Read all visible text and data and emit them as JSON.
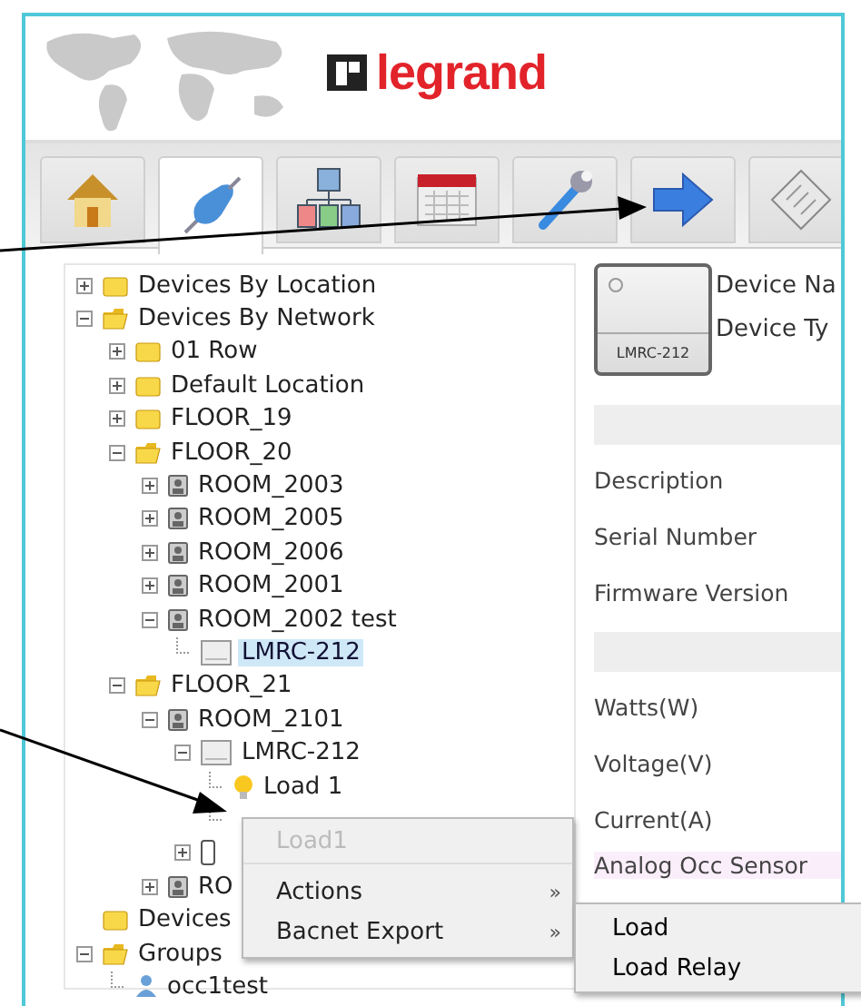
{
  "header": {
    "logo": "legrand"
  },
  "tabs": [
    {
      "kind": "home",
      "selected": false
    },
    {
      "kind": "plug",
      "selected": true
    },
    {
      "kind": "network",
      "selected": false
    },
    {
      "kind": "calendar",
      "selected": false
    },
    {
      "kind": "wrench",
      "selected": false
    },
    {
      "kind": "arrow",
      "selected": false
    },
    {
      "kind": "document",
      "selected": false
    }
  ],
  "tree": [
    {
      "label": "Devices By Location",
      "kind": "folder",
      "expanded": false,
      "selected": false
    },
    {
      "label": "Devices By Network",
      "kind": "folder",
      "expanded": true,
      "selected": false,
      "children": [
        {
          "label": "01 Row",
          "kind": "folder",
          "expanded": false,
          "selected": false
        },
        {
          "label": "Default Location",
          "kind": "folder",
          "expanded": false,
          "selected": false
        },
        {
          "label": "FLOOR_19",
          "kind": "folder",
          "expanded": false,
          "selected": false
        },
        {
          "label": "FLOOR_20",
          "kind": "folder",
          "expanded": true,
          "selected": false,
          "children": [
            {
              "label": "ROOM_2003",
              "kind": "room",
              "expanded": false,
              "selected": false
            },
            {
              "label": "ROOM_2005",
              "kind": "room",
              "expanded": false,
              "selected": false
            },
            {
              "label": "ROOM_2006",
              "kind": "room",
              "expanded": false,
              "selected": false
            },
            {
              "label": "ROOM_2001",
              "kind": "room",
              "expanded": false,
              "selected": false
            },
            {
              "label": "ROOM_2002 test",
              "kind": "room",
              "expanded": true,
              "selected": false,
              "children": [
                {
                  "label": "LMRC-212",
                  "kind": "device",
                  "selected": true
                }
              ]
            }
          ]
        },
        {
          "label": "FLOOR_21",
          "kind": "folder",
          "expanded": true,
          "selected": false,
          "children": [
            {
              "label": "ROOM_2101",
              "kind": "room",
              "expanded": true,
              "selected": false,
              "children": [
                {
                  "label": "LMRC-212",
                  "kind": "device",
                  "expanded": true,
                  "selected": false,
                  "children": [
                    {
                      "label": "Load 1",
                      "kind": "bulb",
                      "selected": false
                    },
                    {
                      "kind": "leaf"
                    }
                  ]
                },
                {
                  "kind": "phone",
                  "expanded": false
                }
              ]
            },
            {
              "label": "RO",
              "kind": "room",
              "expanded": false,
              "selected": false
            }
          ]
        }
      ]
    },
    {
      "label": "Devices",
      "kind": "folder",
      "selected": false
    },
    {
      "label": "Groups",
      "kind": "folder",
      "expanded": true,
      "selected": false,
      "children": [
        {
          "label": "occ1test",
          "kind": "person",
          "selected": false
        }
      ]
    }
  ],
  "device": {
    "image_label": "LMRC-212",
    "fields": [
      "Device Na",
      "Device Ty"
    ],
    "sections": [
      {
        "properties": [
          "Description",
          "Serial Number",
          "Firmware Version"
        ]
      },
      {
        "properties": [
          "Watts(W)",
          "Voltage(V)",
          "Current(A)",
          "Analog Occ Sensor"
        ]
      }
    ]
  },
  "context_menu": {
    "items": [
      {
        "label": "Load1",
        "disabled": true
      },
      {
        "label": "Actions",
        "disabled": false,
        "arrow": "»"
      },
      {
        "label": "Bacnet Export",
        "disabled": false,
        "arrow": "»"
      }
    ]
  },
  "submenu": {
    "items": [
      {
        "label": "Load"
      },
      {
        "label": "Load Relay"
      }
    ]
  }
}
